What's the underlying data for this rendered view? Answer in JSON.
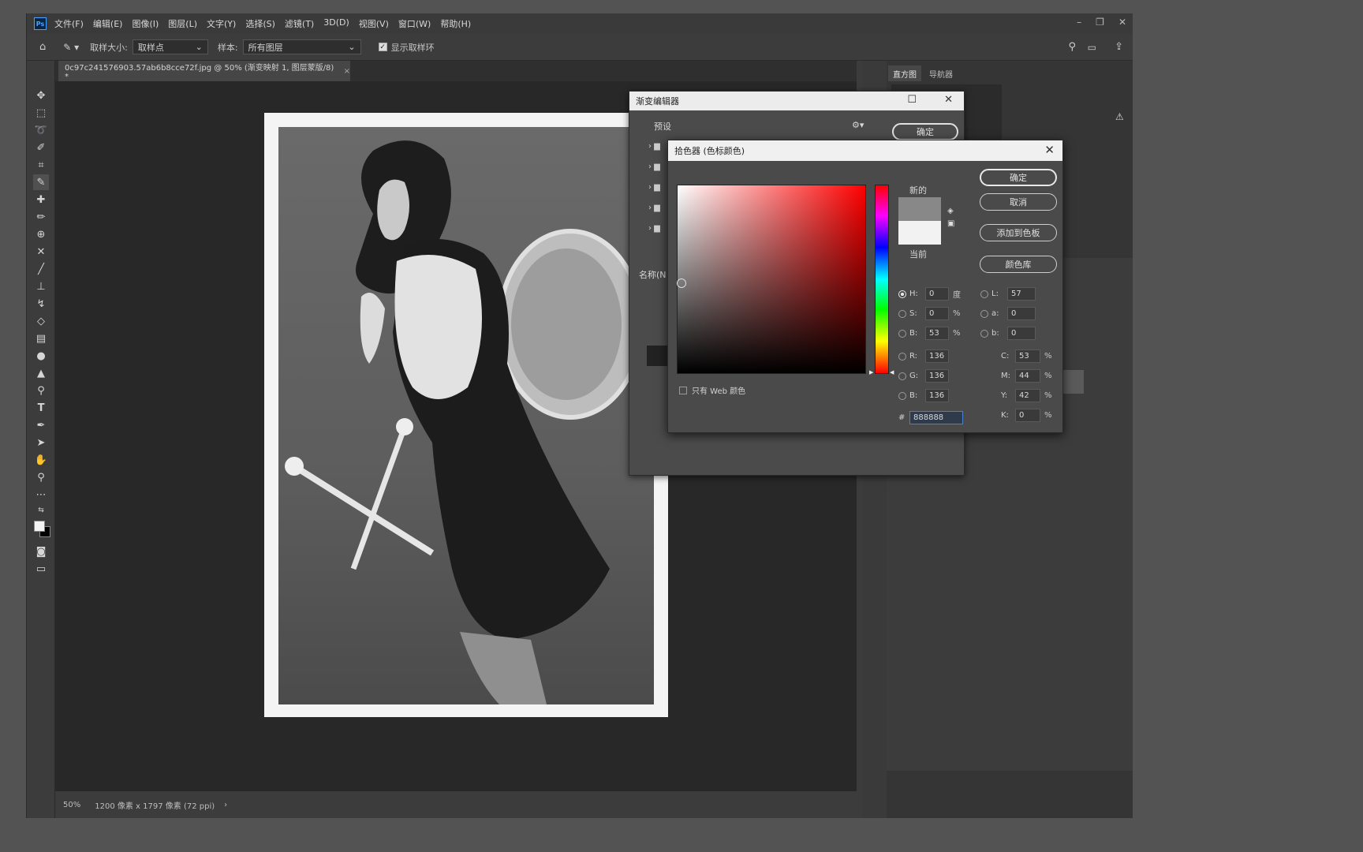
{
  "menubar": {
    "logo": "Ps",
    "items": [
      "文件(F)",
      "编辑(E)",
      "图像(I)",
      "图层(L)",
      "文字(Y)",
      "选择(S)",
      "滤镜(T)",
      "3D(D)",
      "视图(V)",
      "窗口(W)",
      "帮助(H)"
    ]
  },
  "options": {
    "sample_size_label": "取样大小:",
    "sample_size_value": "取样点",
    "sample_label": "样本:",
    "sample_value": "所有图层",
    "show_ring_label": "显示取样环"
  },
  "document": {
    "tab_title": "0c97c241576903.57ab6b8cce72f.jpg @ 50% (渐变映射 1, 图层蒙版/8) *",
    "zoom": "50%",
    "info": "1200 像素 x 1797 像素 (72 ppi)"
  },
  "panels": {
    "tabs": [
      "直方图",
      "导航器"
    ]
  },
  "gradient_editor": {
    "title": "渐变编辑器",
    "presets_label": "预设",
    "ok_label": "确定",
    "name_label": "名称(N",
    "folder_count": 5
  },
  "color_picker": {
    "title": "拾色器 (色标颜色)",
    "new_label": "新的",
    "current_label": "当前",
    "buttons": {
      "ok": "确定",
      "cancel": "取消",
      "add_swatch": "添加到色板",
      "libraries": "颜色库"
    },
    "web_only_label": "只有 Web 颜色",
    "hsb": [
      {
        "label": "H:",
        "value": "0",
        "unit": "度",
        "selected": true
      },
      {
        "label": "S:",
        "value": "0",
        "unit": "%",
        "selected": false
      },
      {
        "label": "B:",
        "value": "53",
        "unit": "%",
        "selected": false
      }
    ],
    "rgb": [
      {
        "label": "R:",
        "value": "136"
      },
      {
        "label": "G:",
        "value": "136"
      },
      {
        "label": "B:",
        "value": "136"
      }
    ],
    "lab": [
      {
        "label": "L:",
        "value": "57"
      },
      {
        "label": "a:",
        "value": "0"
      },
      {
        "label": "b:",
        "value": "0"
      }
    ],
    "cmyk": [
      {
        "label": "C:",
        "value": "53",
        "unit": "%"
      },
      {
        "label": "M:",
        "value": "44",
        "unit": "%"
      },
      {
        "label": "Y:",
        "value": "42",
        "unit": "%"
      },
      {
        "label": "K:",
        "value": "0",
        "unit": "%"
      }
    ],
    "hex_label": "#",
    "hex_value": "888888",
    "new_color": "#888888",
    "current_color": "#f2f2f2"
  }
}
